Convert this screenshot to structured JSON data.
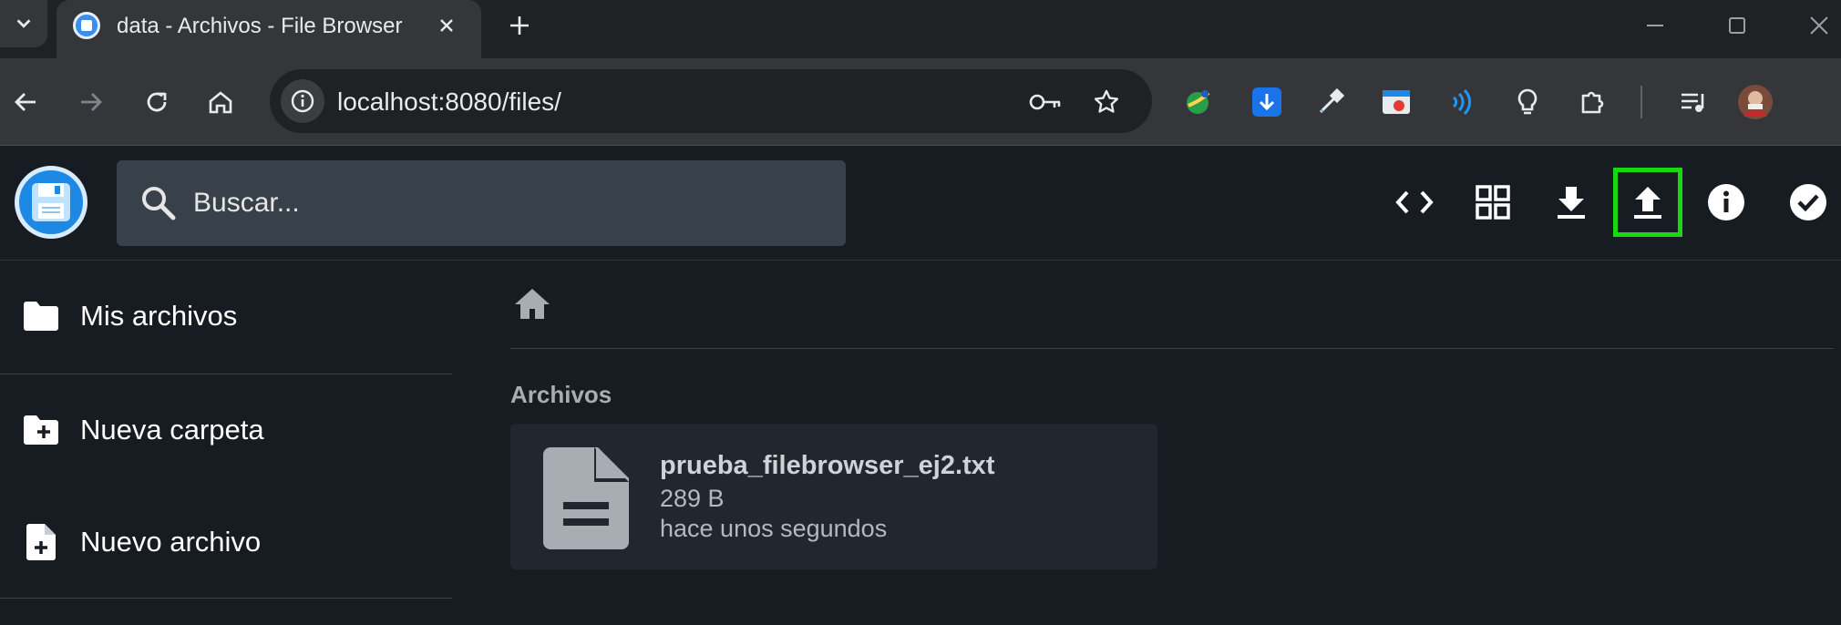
{
  "browser": {
    "tab_title": "data - Archivos - File Browser",
    "url": "localhost:8080/files/"
  },
  "colors": {
    "background": "#161c22",
    "search_bg": "#38414a",
    "card_bg": "#20272e",
    "highlight": "#18d80f",
    "brand": "#1e88e5"
  },
  "header": {
    "search_placeholder": "Buscar...",
    "actions": [
      "code-icon",
      "grid-view-icon",
      "download-icon",
      "upload-icon",
      "info-icon",
      "check-circle-icon"
    ]
  },
  "sidebar": {
    "items": [
      {
        "label": "Mis archivos",
        "icon": "folder-icon"
      },
      {
        "label": "Nueva carpeta",
        "icon": "new-folder-icon"
      },
      {
        "label": "Nuevo archivo",
        "icon": "new-file-icon"
      }
    ]
  },
  "main": {
    "section_title": "Archivos",
    "files": [
      {
        "name": "prueba_filebrowser_ej2.txt",
        "size": "289 B",
        "modified": "hace unos segundos",
        "icon": "document-icon"
      }
    ]
  }
}
